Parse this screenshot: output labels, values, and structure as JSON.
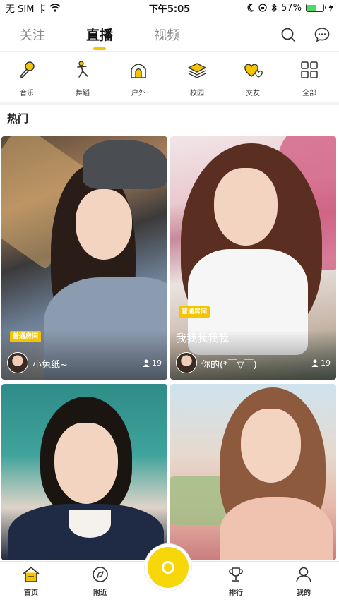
{
  "status_bar": {
    "carrier": "无 SIM 卡",
    "time": "下午5:05",
    "battery_percent": "57%",
    "battery_level": 0.57
  },
  "top_nav": {
    "tabs": [
      {
        "label": "关注",
        "active": false
      },
      {
        "label": "直播",
        "active": true
      },
      {
        "label": "视频",
        "active": false
      }
    ],
    "icons": [
      "search-icon",
      "message-icon"
    ],
    "accent_color": "#f5c400"
  },
  "categories": [
    {
      "label": "音乐",
      "icon": "microphone-icon"
    },
    {
      "label": "舞蹈",
      "icon": "dancer-icon"
    },
    {
      "label": "户外",
      "icon": "tent-icon"
    },
    {
      "label": "校园",
      "icon": "books-icon"
    },
    {
      "label": "交友",
      "icon": "hearts-icon"
    },
    {
      "label": "全部",
      "icon": "grid-icon"
    }
  ],
  "section_title": "热门",
  "streams": [
    {
      "badge": "普通房间",
      "title": "",
      "host_name": "小兔纸~",
      "viewers": "19"
    },
    {
      "badge": "普通房间",
      "title": "我我我我我",
      "host_name": "你的(*￣▽￣)",
      "viewers": "19"
    },
    {
      "badge": "",
      "title": "",
      "host_name": "",
      "viewers": ""
    },
    {
      "badge": "",
      "title": "",
      "host_name": "",
      "viewers": ""
    }
  ],
  "bottom_tabs": [
    {
      "label": "首页",
      "icon": "home-icon",
      "active": true
    },
    {
      "label": "附近",
      "icon": "compass-icon",
      "active": false
    },
    {
      "label": "排行",
      "icon": "trophy-icon",
      "active": false
    },
    {
      "label": "我的",
      "icon": "profile-icon",
      "active": false
    }
  ],
  "go_live_color": "#f8d70a"
}
